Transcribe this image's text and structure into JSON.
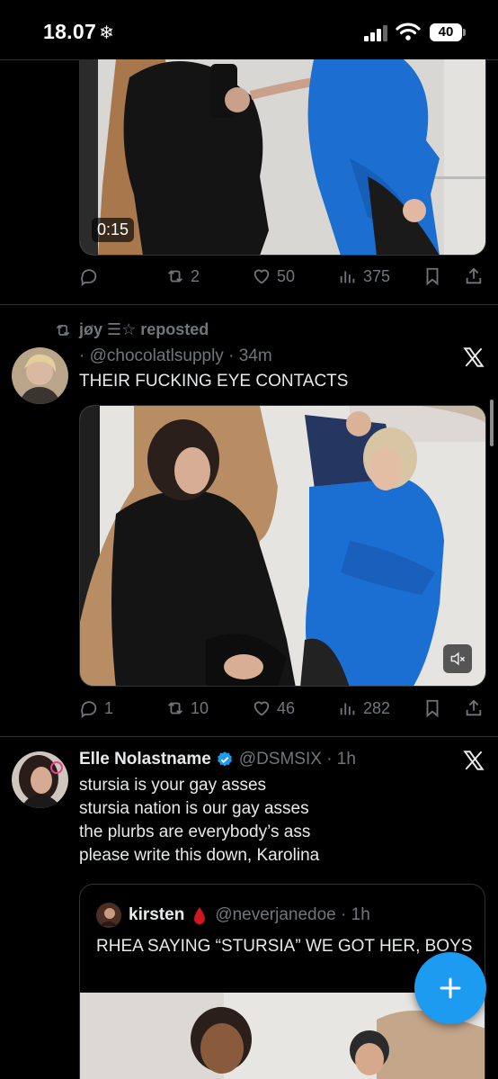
{
  "status_bar": {
    "time": "18.07",
    "snow": "❄",
    "battery": "40"
  },
  "tweet1": {
    "video_duration": "0:15",
    "actions": {
      "reply": "",
      "repost": "2",
      "like": "50",
      "views": "375"
    }
  },
  "tweet2": {
    "repost_by": "jøy ☰☆ reposted",
    "handle": "· @chocolatlsupply · 34m",
    "text": "THEIR FUCKING EYE CONTACTS",
    "actions": {
      "reply": "1",
      "repost": "10",
      "like": "46",
      "views": "282"
    }
  },
  "tweet3": {
    "name": "Elle Nolastname",
    "handle": "@DSMSIX · 1h",
    "text_lines": [
      "stursia is your gay asses",
      "stursia nation is our gay asses",
      "the plurbs are everybody’s ass",
      "please write this down, Karolina"
    ],
    "quote": {
      "name": "kirsten",
      "handle": "@neverjanedoe · 1h",
      "text": "RHEA SAYING “STURSIA” WE GOT HER, BOYS"
    }
  },
  "colors": {
    "accent": "#1d9bf0",
    "muted": "#71767b",
    "background": "#000000",
    "verified": "#1d9bf0"
  }
}
